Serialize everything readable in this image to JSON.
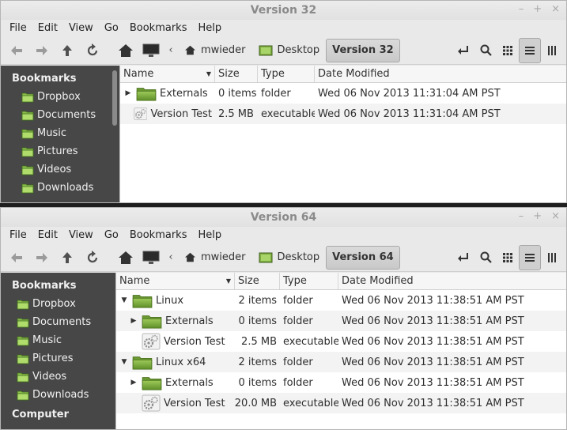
{
  "windows": [
    {
      "title": "Version 32",
      "menu": [
        "File",
        "Edit",
        "View",
        "Go",
        "Bookmarks",
        "Help"
      ],
      "breadcrumbs": [
        "mwieder",
        "Desktop",
        "Version 32"
      ],
      "sidebar": {
        "heading": "Bookmarks",
        "items": [
          "Dropbox",
          "Documents",
          "Music",
          "Pictures",
          "Videos",
          "Downloads"
        ]
      },
      "columns": {
        "name": "Name",
        "size": "Size",
        "type": "Type",
        "date": "Date Modified"
      },
      "rows": [
        {
          "name": "Externals",
          "size": "0 items",
          "type": "folder",
          "date": "Wed 06 Nov 2013 11:31:04 AM PST"
        },
        {
          "name": "Version Test",
          "size": "2.5 MB",
          "type": "executable",
          "date": "Wed 06 Nov 2013 11:31:04 AM PST"
        }
      ]
    },
    {
      "title": "Version 64",
      "menu": [
        "File",
        "Edit",
        "View",
        "Go",
        "Bookmarks",
        "Help"
      ],
      "breadcrumbs": [
        "mwieder",
        "Desktop",
        "Version 64"
      ],
      "sidebar": {
        "heading": "Bookmarks",
        "items": [
          "Dropbox",
          "Documents",
          "Music",
          "Pictures",
          "Videos",
          "Downloads"
        ],
        "heading2": "Computer"
      },
      "columns": {
        "name": "Name",
        "size": "Size",
        "type": "Type",
        "date": "Date Modified"
      },
      "rows": [
        {
          "name": "Linux",
          "size": "2 items",
          "type": "folder",
          "date": "Wed 06 Nov 2013 11:38:51 AM PST"
        },
        {
          "name": "Externals",
          "size": "0 items",
          "type": "folder",
          "date": "Wed 06 Nov 2013 11:38:51 AM PST"
        },
        {
          "name": "Version Test",
          "size": "2.5 MB",
          "type": "executable",
          "date": "Wed 06 Nov 2013 11:38:51 AM PST"
        },
        {
          "name": "Linux x64",
          "size": "2 items",
          "type": "folder",
          "date": "Wed 06 Nov 2013 11:38:51 AM PST"
        },
        {
          "name": "Externals",
          "size": "0 items",
          "type": "folder",
          "date": "Wed 06 Nov 2013 11:38:51 AM PST"
        },
        {
          "name": "Version Test",
          "size": "20.0 MB",
          "type": "executable",
          "date": "Wed 06 Nov 2013 11:38:51 AM PST"
        }
      ]
    }
  ],
  "icons": {
    "folder": "folder-icon",
    "executable": "gears-icon"
  },
  "colors": {
    "sidebar_bg": "#474747",
    "folder_green": "#7fae3f",
    "window_bg": "#e9e9e9"
  }
}
